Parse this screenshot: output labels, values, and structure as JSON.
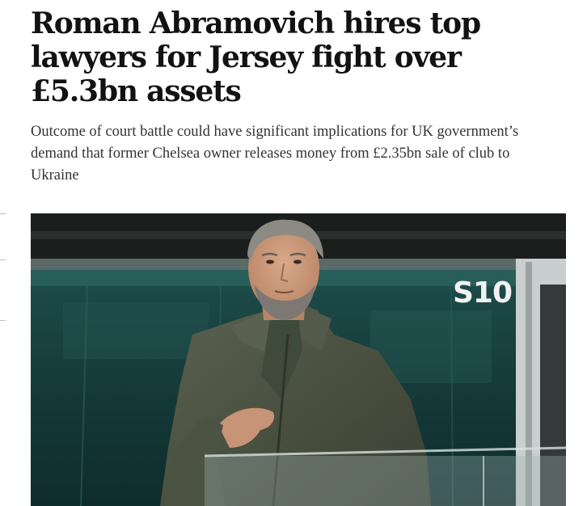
{
  "article": {
    "headline": "Roman Abramovich hires top lawyers for Jersey fight over £5.3bn assets",
    "standfirst": "Outcome of court battle could have significant implications for UK government’s demand that former Chelsea owner releases money from £2.35bn sale of club to Ukraine"
  },
  "photo": {
    "box_sign": "S10"
  },
  "colors": {
    "headline": "#121212",
    "standfirst": "#333333",
    "glass": "#14403f",
    "jacket": "#4b5240"
  }
}
